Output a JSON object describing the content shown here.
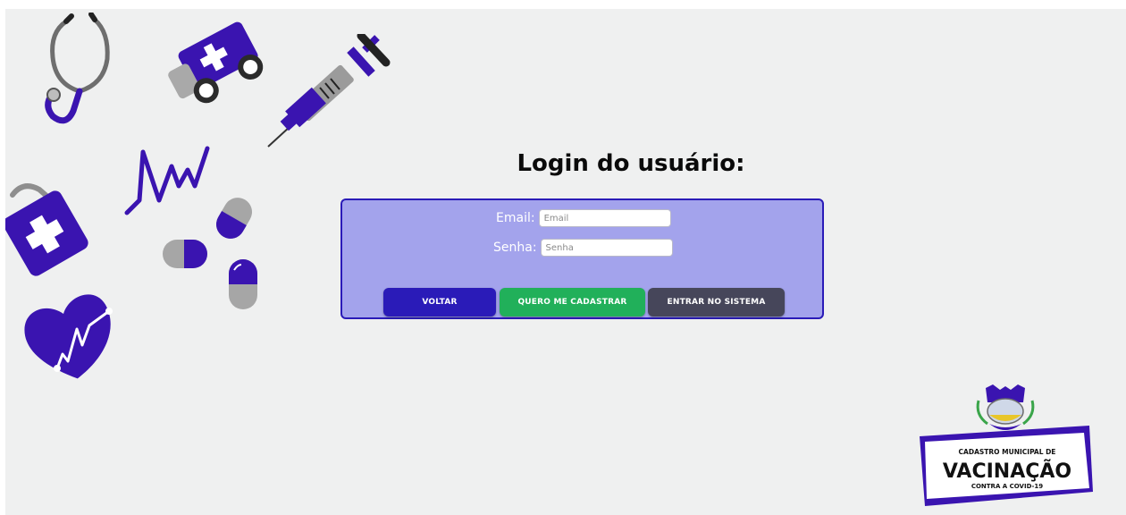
{
  "page": {
    "title": "Login do usuário:"
  },
  "form": {
    "email": {
      "label": "Email:",
      "placeholder": "Email",
      "value": ""
    },
    "password": {
      "label": "Senha:",
      "placeholder": "Senha",
      "value": ""
    }
  },
  "buttons": {
    "back": "VOLTAR",
    "register": "QUERO ME CADASTRAR",
    "login": "ENTRAR NO SISTEMA"
  },
  "logo": {
    "line1": "CADASTRO MUNICIPAL DE",
    "line2": "VACINAÇÃO",
    "line3": "CONTRA A COVID-19"
  },
  "colors": {
    "accent_purple": "#3a14b0",
    "panel_bg": "#a3a3ec",
    "button_back": "#2a1bb8",
    "button_register": "#21b05a",
    "button_login": "#46465a",
    "background": "#eff0f0"
  },
  "icons": [
    "stethoscope-icon",
    "ambulance-icon",
    "syringe-icon",
    "heartbeat-line-icon",
    "medical-kit-icon",
    "pill-capsules-icon",
    "heart-pulse-icon",
    "municipal-seal-icon"
  ]
}
